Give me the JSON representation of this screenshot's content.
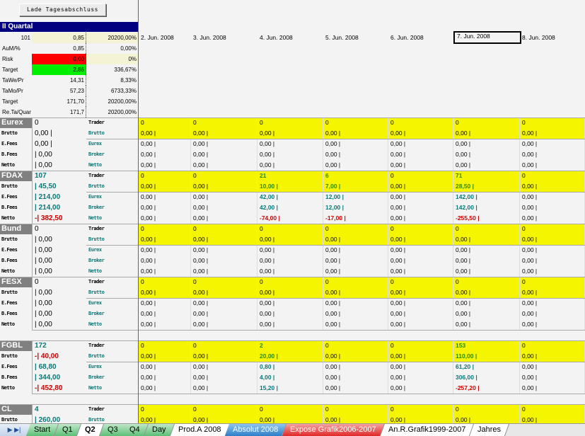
{
  "button": {
    "load": "Lade Tagesabschluss"
  },
  "quartal": "II Quartal",
  "summary": [
    {
      "label": "101",
      "value": "0,85",
      "pct": "20200,00%",
      "vbg": "#f5f3d5",
      "pbg": "#f5f3d5"
    },
    {
      "label": "AuM/%",
      "value": "0,85",
      "pct": "0,00%"
    },
    {
      "label": "Risk",
      "value": "0,00",
      "pct": "0%",
      "vbg": "#ff0000",
      "pbg": "#f5f3d5"
    },
    {
      "label": "Target",
      "value": "2,86",
      "pct": "336,67%",
      "vbg": "#00ee00"
    },
    {
      "label": "TaWe/Pr",
      "value": "14,31",
      "pct": "8,33%"
    },
    {
      "label": "TaMo/Pr",
      "value": "57,23",
      "pct": "6733,33%"
    },
    {
      "label": "Target",
      "value": "171,70",
      "pct": "20200,00%"
    },
    {
      "label": "Re.Ta/Quar",
      "value": "171,7",
      "pct": "20200,00%"
    }
  ],
  "dates": [
    "2. Jun. 2008",
    "3. Jun. 2008",
    "4. Jun. 2008",
    "5. Jun. 2008",
    "6. Jun. 2008",
    "7. Jun. 2008",
    "8. Jun. 2008"
  ],
  "selected_date_index": 5,
  "row_labels": [
    "Brutto",
    "E.Fees",
    "B.Fees",
    "Netto"
  ],
  "mid_labels": [
    "Trader",
    "Brutto",
    "Eurex",
    "Broker",
    "Netto"
  ],
  "colors": {
    "yellow": "#f5f500",
    "header": "#000080",
    "teal": "#0a7878",
    "red": "#d00000"
  },
  "blocks": [
    {
      "name": "Eurex",
      "left": [
        "0",
        "0,00 |",
        "0,00 |",
        "| 0,00",
        "| 0,00"
      ],
      "days": [
        [
          "0",
          "0,00 |",
          "0,00 |",
          "0,00 |",
          "0,00 |"
        ],
        [
          "0",
          "0,00 |",
          "0,00 |",
          "0,00 |",
          "0,00 |"
        ],
        [
          "0",
          "0,00 |",
          "0,00 |",
          "0,00 |",
          "0,00 |"
        ],
        [
          "0",
          "0,00 |",
          "0,00 |",
          "0,00 |",
          "0,00 |"
        ],
        [
          "0",
          "0,00 |",
          "0,00 |",
          "0,00 |",
          "0,00 |"
        ],
        [
          "0",
          "0,00 |",
          "0,00 |",
          "0,00 |",
          "0,00 |"
        ],
        [
          "0",
          "0,00 |",
          "0,00 |",
          "0,00 |",
          "0,00 |"
        ]
      ]
    },
    {
      "name": "FDAX",
      "left": [
        "107",
        "| 45,50",
        "| 214,00",
        "| 214,00",
        "-| 382,50"
      ],
      "days": [
        [
          "0",
          "0,00 |",
          "0,00 |",
          "0,00 |",
          "0,00 |"
        ],
        [
          "0",
          "0,00 |",
          "0,00 |",
          "0,00 |",
          "0,00 |"
        ],
        [
          "21",
          "10,00 |",
          "42,00 |",
          "42,00 |",
          "-74,00 |"
        ],
        [
          "6",
          "7,00 |",
          "12,00 |",
          "12,00 |",
          "-17,00 |"
        ],
        [
          "0",
          "0,00 |",
          "0,00 |",
          "0,00 |",
          "0,00 |"
        ],
        [
          "71",
          "28,50 |",
          "142,00 |",
          "142,00 |",
          "-255,50 |"
        ],
        [
          "0",
          "0,00 |",
          "0,00 |",
          "0,00 |",
          "0,00 |"
        ]
      ]
    },
    {
      "name": "Bund",
      "left": [
        "0",
        "| 0,00",
        "| 0,00",
        "| 0,00",
        "| 0,00"
      ],
      "days": [
        [
          "0",
          "0,00 |",
          "0,00 |",
          "0,00 |",
          "0,00 |"
        ],
        [
          "0",
          "0,00 |",
          "0,00 |",
          "0,00 |",
          "0,00 |"
        ],
        [
          "0",
          "0,00 |",
          "0,00 |",
          "0,00 |",
          "0,00 |"
        ],
        [
          "0",
          "0,00 |",
          "0,00 |",
          "0,00 |",
          "0,00 |"
        ],
        [
          "0",
          "0,00 |",
          "0,00 |",
          "0,00 |",
          "0,00 |"
        ],
        [
          "0",
          "0,00 |",
          "0,00 |",
          "0,00 |",
          "0,00 |"
        ],
        [
          "0",
          "0,00 |",
          "0,00 |",
          "0,00 |",
          "0,00 |"
        ]
      ]
    },
    {
      "name": "FESX",
      "left": [
        "0",
        "| 0,00",
        "| 0,00",
        "| 0,00",
        "| 0,00"
      ],
      "days": [
        [
          "0",
          "0,00 |",
          "0,00 |",
          "0,00 |",
          "0,00 |"
        ],
        [
          "0",
          "0,00 |",
          "0,00 |",
          "0,00 |",
          "0,00 |"
        ],
        [
          "0",
          "0,00 |",
          "0,00 |",
          "0,00 |",
          "0,00 |"
        ],
        [
          "0",
          "0,00 |",
          "0,00 |",
          "0,00 |",
          "0,00 |"
        ],
        [
          "0",
          "0,00 |",
          "0,00 |",
          "0,00 |",
          "0,00 |"
        ],
        [
          "0",
          "0,00 |",
          "0,00 |",
          "0,00 |",
          "0,00 |"
        ],
        [
          "0",
          "0,00 |",
          "0,00 |",
          "0,00 |",
          "0,00 |"
        ]
      ]
    },
    {
      "name": "FGBL",
      "left": [
        "172",
        "-| 40,00",
        "| 68,80",
        "| 344,00",
        "-| 452,80"
      ],
      "days": [
        [
          "0",
          "0,00 |",
          "0,00 |",
          "0,00 |",
          "0,00 |"
        ],
        [
          "0",
          "0,00 |",
          "0,00 |",
          "0,00 |",
          "0,00 |"
        ],
        [
          "2",
          "20,00 |",
          "0,80 |",
          "4,00 |",
          "15,20 |"
        ],
        [
          "0",
          "0,00 |",
          "0,00 |",
          "0,00 |",
          "0,00 |"
        ],
        [
          "0",
          "0,00 |",
          "0,00 |",
          "0,00 |",
          "0,00 |"
        ],
        [
          "153",
          "110,00 |",
          "61,20 |",
          "306,00 |",
          "-257,20 |"
        ],
        [
          "0",
          "0,00 |",
          "0,00 |",
          "0,00 |",
          "0,00 |"
        ]
      ]
    },
    {
      "name": "CL",
      "left": [
        "4",
        "| 260,00"
      ],
      "days": [
        [
          "0",
          "0,00 |"
        ],
        [
          "0",
          "0,00 |"
        ],
        [
          "0",
          "0,00 |"
        ],
        [
          "0",
          "0,00 |"
        ],
        [
          "0",
          "0,00 |"
        ],
        [
          "0",
          "0,00 |"
        ],
        [
          "0",
          "0,00 |"
        ]
      ]
    }
  ],
  "tabs": [
    {
      "label": "Start",
      "style": "tg"
    },
    {
      "label": "Q1",
      "style": "tg"
    },
    {
      "label": "Q2",
      "style": "tw",
      "active": true
    },
    {
      "label": "Q3",
      "style": "tg"
    },
    {
      "label": "Q4",
      "style": "tg"
    },
    {
      "label": "Day",
      "style": "tg"
    },
    {
      "label": "Prod.A 2008",
      "style": "tw"
    },
    {
      "label": "Absolut 2008",
      "style": "tb"
    },
    {
      "label": "Expose Grafik2006-2007",
      "style": "tr"
    },
    {
      "label": "An.R.Grafik1999-2007",
      "style": "tw"
    },
    {
      "label": "Jahres",
      "style": "tw"
    }
  ],
  "nav_icons": [
    "next-sheet-icon",
    "last-sheet-icon"
  ]
}
